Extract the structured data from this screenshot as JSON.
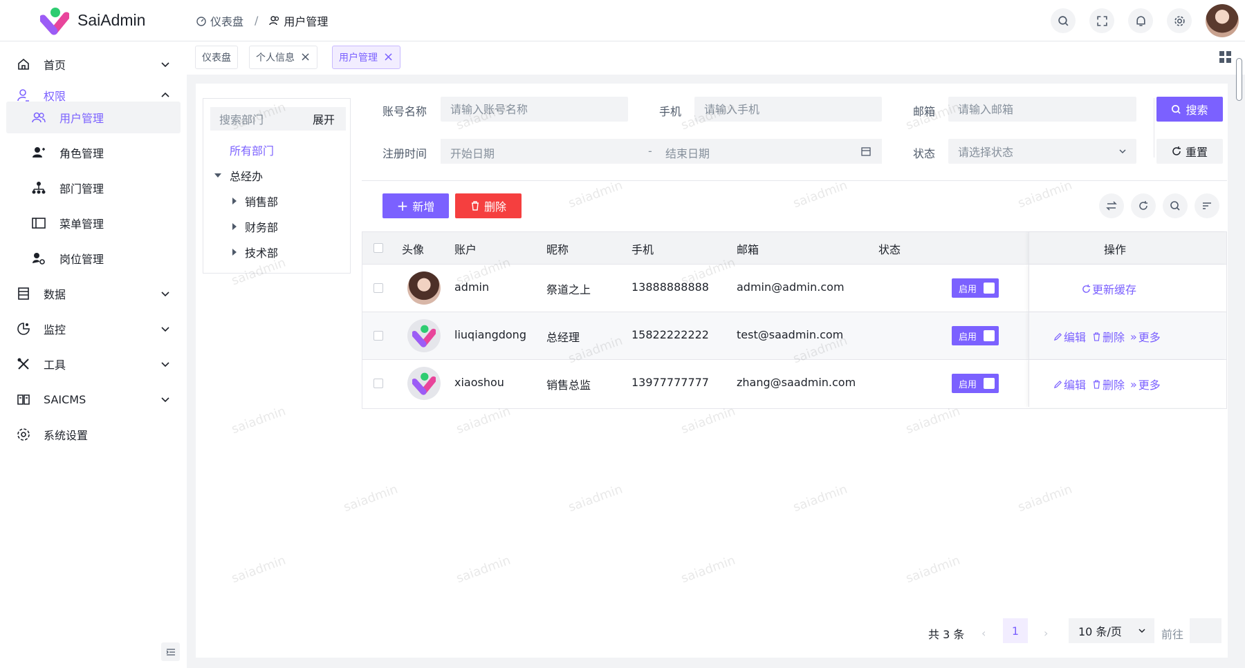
{
  "app": {
    "name": "SaiAdmin"
  },
  "breadcrumb": [
    {
      "label": "仪表盘",
      "icon": "dashboard-icon"
    },
    {
      "label": "用户管理",
      "icon": "users-icon"
    }
  ],
  "sidebar": {
    "items": [
      {
        "label": "首页",
        "icon": "home-icon",
        "state": "collapsed"
      },
      {
        "label": "权限",
        "icon": "user-permission-icon",
        "state": "expanded"
      },
      {
        "label": "用户管理",
        "icon": "users-icon",
        "state": "active"
      },
      {
        "label": "角色管理",
        "icon": "role-icon"
      },
      {
        "label": "部门管理",
        "icon": "org-chart-icon"
      },
      {
        "label": "菜单管理",
        "icon": "menu-layout-icon"
      },
      {
        "label": "岗位管理",
        "icon": "user-gear-icon"
      },
      {
        "label": "数据",
        "icon": "database-icon",
        "state": "collapsed"
      },
      {
        "label": "监控",
        "icon": "monitor-icon",
        "state": "collapsed"
      },
      {
        "label": "工具",
        "icon": "tools-icon",
        "state": "collapsed"
      },
      {
        "label": "SAICMS",
        "icon": "book-icon",
        "state": "collapsed"
      },
      {
        "label": "系统设置",
        "icon": "gear-icon"
      }
    ]
  },
  "tabs": [
    {
      "label": "仪表盘",
      "closable": false
    },
    {
      "label": "个人信息",
      "closable": true
    },
    {
      "label": "用户管理",
      "closable": true,
      "active": true
    }
  ],
  "dept_tree": {
    "search_placeholder": "搜索部门",
    "expand_label": "展开",
    "all_label": "所有部门",
    "root": "总经办",
    "children": [
      "销售部",
      "财务部",
      "技术部"
    ]
  },
  "filters": {
    "account_label": "账号名称",
    "account_placeholder": "请输入账号名称",
    "phone_label": "手机",
    "phone_placeholder": "请输入手机",
    "email_label": "邮箱",
    "email_placeholder": "请输入邮箱",
    "date_label": "注册时间",
    "date_start_placeholder": "开始日期",
    "date_sep": "-",
    "date_end_placeholder": "结束日期",
    "status_label": "状态",
    "status_placeholder": "请选择状态",
    "search_button": "搜索",
    "reset_button": "重置"
  },
  "toolbar": {
    "add_button": "新增",
    "delete_button": "删除"
  },
  "table": {
    "columns": [
      "头像",
      "账户",
      "昵称",
      "手机",
      "邮箱",
      "状态",
      "操作"
    ],
    "rows": [
      {
        "account": "admin",
        "nickname": "祭道之上",
        "phone": "13888888888",
        "email": "admin@admin.com",
        "status": "启用",
        "avatar": "photo",
        "actions": [
          "更新缓存"
        ]
      },
      {
        "account": "liuqiangdong",
        "nickname": "总经理",
        "phone": "15822222222",
        "email": "test@saadmin.com",
        "status": "启用",
        "avatar": "logo",
        "actions": [
          "编辑",
          "删除",
          "更多"
        ]
      },
      {
        "account": "xiaoshou",
        "nickname": "销售总监",
        "phone": "13977777777",
        "email": "zhang@saadmin.com",
        "status": "启用",
        "avatar": "logo",
        "actions": [
          "编辑",
          "删除",
          "更多"
        ]
      }
    ]
  },
  "pagination": {
    "total": "共 3 条",
    "current_page": "1",
    "page_size": "10 条/页",
    "goto_label": "前往"
  },
  "watermark": "saiadmin",
  "colors": {
    "primary": "#7b61ff",
    "danger": "#f53f3f"
  }
}
